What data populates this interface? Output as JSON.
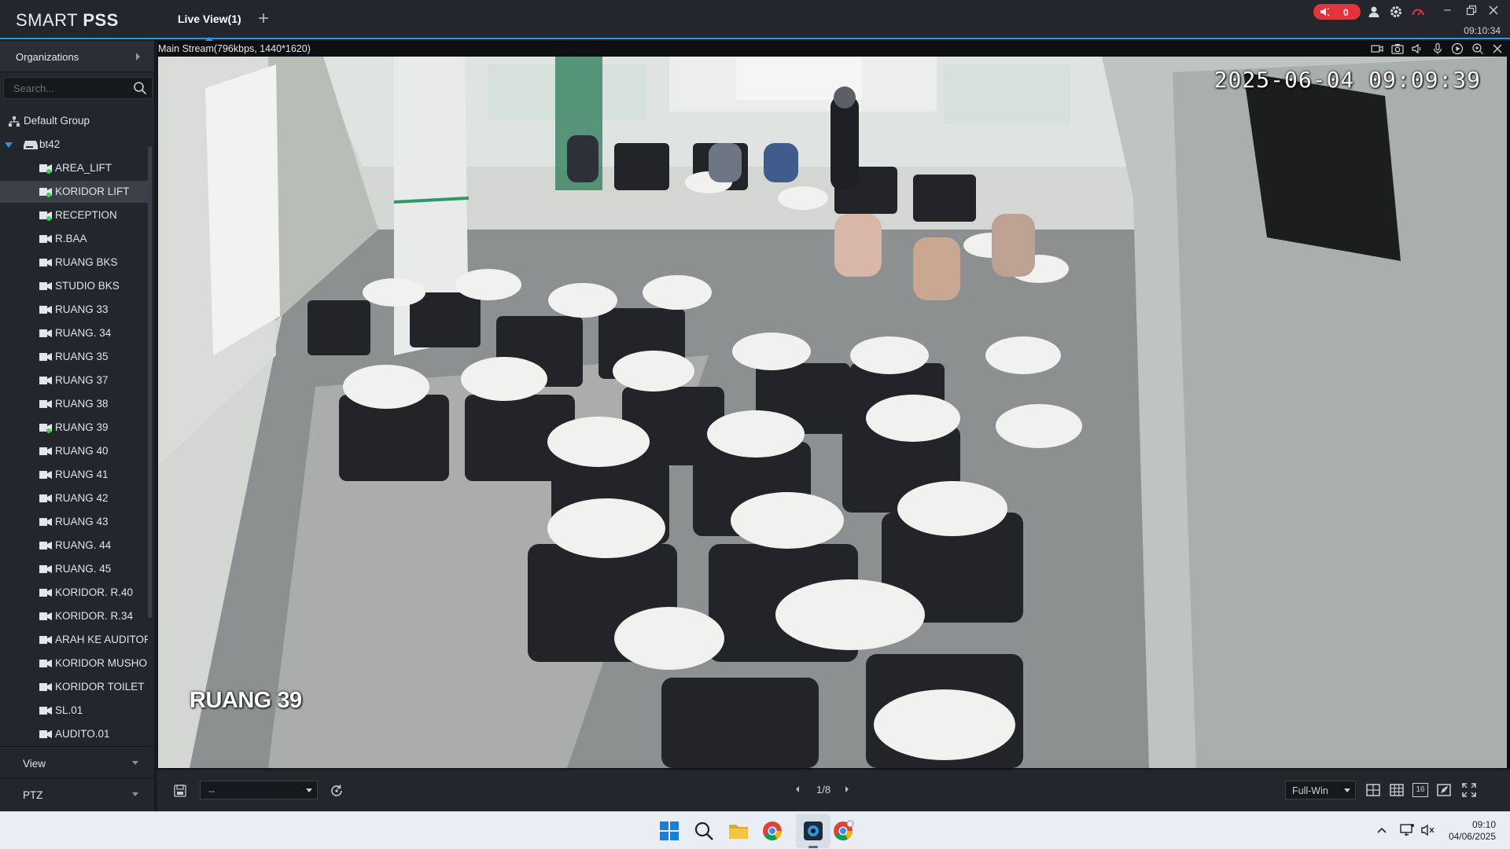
{
  "app": {
    "logo_light": "SMART ",
    "logo_bold": "PSS",
    "tab_label": "Live View(1)",
    "alarm_count": "0",
    "clock": "09:10:34"
  },
  "sidebar": {
    "organizations_label": "Organizations",
    "search_placeholder": "Search...",
    "group_label": "Default Group",
    "device_label": "bt42",
    "channels": [
      {
        "label": "AREA_LIFT",
        "online": true
      },
      {
        "label": "KORIDOR LIFT",
        "online": true,
        "selected": true
      },
      {
        "label": "RECEPTION",
        "online": true
      },
      {
        "label": "R.BAA",
        "online": false
      },
      {
        "label": "RUANG BKS",
        "online": false
      },
      {
        "label": "STUDIO BKS",
        "online": false
      },
      {
        "label": "RUANG 33",
        "online": false
      },
      {
        "label": "RUANG. 34",
        "online": false
      },
      {
        "label": "RUANG 35",
        "online": false
      },
      {
        "label": "RUANG  37",
        "online": false
      },
      {
        "label": "RUANG 38",
        "online": false
      },
      {
        "label": "RUANG 39",
        "online": true
      },
      {
        "label": "RUANG 40",
        "online": false
      },
      {
        "label": "RUANG 41",
        "online": false
      },
      {
        "label": "RUANG 42",
        "online": false
      },
      {
        "label": "RUANG 43",
        "online": false
      },
      {
        "label": "RUANG. 44",
        "online": false
      },
      {
        "label": "RUANG. 45",
        "online": false
      },
      {
        "label": "KORIDOR. R.40",
        "online": false
      },
      {
        "label": "KORIDOR. R.34",
        "online": false
      },
      {
        "label": "ARAH KE AUDITORIUM",
        "online": false
      },
      {
        "label": "KORIDOR MUSHOLA",
        "online": false
      },
      {
        "label": "KORIDOR TOILET",
        "online": false
      },
      {
        "label": "SL.01",
        "online": false
      },
      {
        "label": "AUDITO.01",
        "online": false
      }
    ],
    "view_label": "View",
    "ptz_label": "PTZ"
  },
  "video": {
    "stream_info": "Main Stream(796kbps, 1440*1620)",
    "osd_timestamp": "2025-06-04 09:09:39",
    "osd_channel": "RUANG 39"
  },
  "bottom": {
    "view_select_value": "--",
    "page": "1/8",
    "window_mode": "Full-Win",
    "layout_16_label": "16"
  },
  "taskbar": {
    "time": "09:10",
    "date": "04/06/2025"
  },
  "colors": {
    "accent": "#2f95d6",
    "alarm": "#e2343b",
    "online": "#3bd14c"
  }
}
